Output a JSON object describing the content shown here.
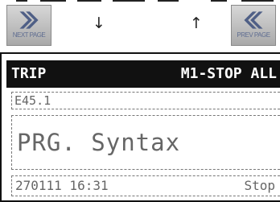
{
  "nav": {
    "next_label": "NEXT PAGE",
    "prev_label": "PREV PAGE",
    "next_icon": "chevrons-right-icon",
    "prev_icon": "chevrons-left-icon",
    "down_arrow": "↓",
    "up_arrow": "↑"
  },
  "display": {
    "header_left": "TRIP",
    "header_right": "M1-STOP ALL",
    "error_code": "E45.1",
    "message": "PRG. Syntax",
    "datetime": "270111 16:31",
    "status": "Stop"
  },
  "colors": {
    "header_bg": "#111111",
    "header_text": "#ffffff",
    "text_gray": "#666666",
    "button_label": "#5f6d91"
  }
}
